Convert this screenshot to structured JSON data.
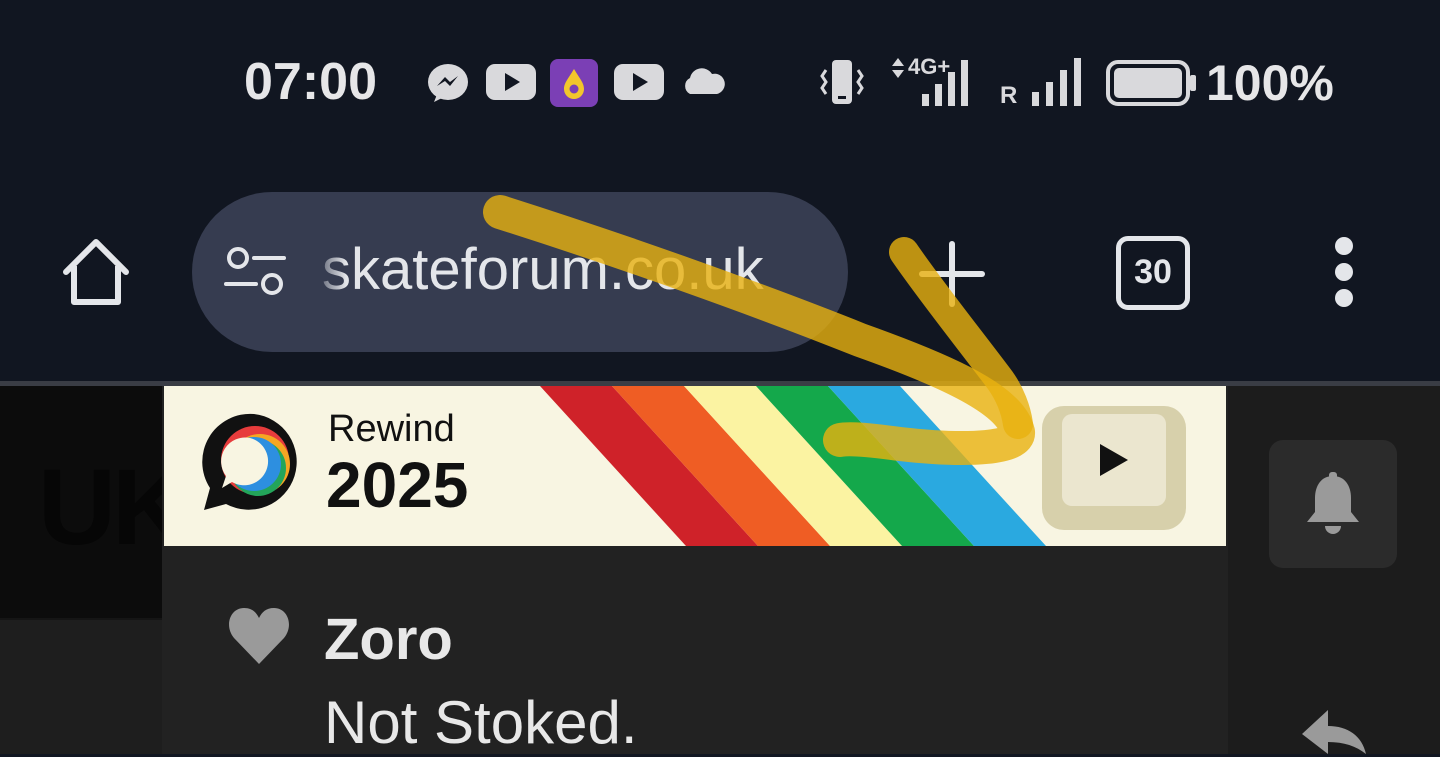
{
  "status_bar": {
    "time": "07:00",
    "notification_icons": [
      "messenger-icon",
      "youtube-icon",
      "purple-app-icon",
      "youtube-icon",
      "cloud-icon"
    ],
    "network_label": "4G+",
    "roaming_label": "R",
    "battery_percent": "100%",
    "battery_level": 1.0
  },
  "browser": {
    "url": "skateforum.co.uk",
    "tab_count": "30",
    "icons": [
      "home-icon",
      "site-settings-icon",
      "new-tab-icon",
      "more-vert-icon"
    ]
  },
  "page": {
    "site_logo_text": "UK",
    "banner": {
      "label": "Rewind",
      "year": "2025",
      "stripe_colors": [
        "#cf2229",
        "#ef5d24",
        "#fbf3a2",
        "#14a84b",
        "#2aa9e0"
      ]
    },
    "comment": {
      "author": "Zoro",
      "body": "Not Stoked."
    },
    "right_icons": [
      "bell-icon",
      "reply-icon"
    ]
  },
  "colors": {
    "chrome_bg": "#111621",
    "omnibox_bg": "#363c50",
    "annotation": "#e9b20f"
  }
}
